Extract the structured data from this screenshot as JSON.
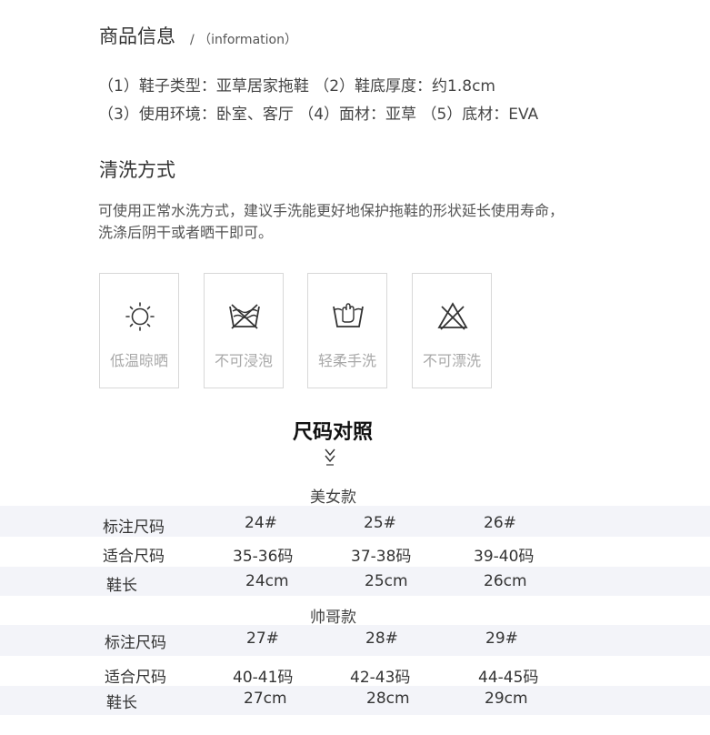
{
  "section_info": {
    "title": "商品信息",
    "title_sub": "/ （information）",
    "line1": "（1）鞋子类型：亚草居家拖鞋 （2）鞋底厚度：约1.8cm",
    "line2": "（3）使用环境：卧室、客厅 （4）面材：亚草 （5）底材：EVA"
  },
  "section_wash": {
    "title": "清洗方式",
    "desc_line1": "可使用正常水洗方式，建议手洗能更好地保护拖鞋的形状延长使用寿命，",
    "desc_line2": "洗涤后阴干或者晒干即可。",
    "care_items": [
      {
        "icon": "sun-icon",
        "label": "低温晾晒"
      },
      {
        "icon": "no-soak-icon",
        "label": "不可浸泡"
      },
      {
        "icon": "hand-wash-icon",
        "label": "轻柔手洗"
      },
      {
        "icon": "no-bleach-icon",
        "label": "不可漂洗"
      }
    ]
  },
  "size_chart": {
    "title": "尺码对照",
    "women": {
      "label": "美女款",
      "rows": [
        {
          "label": "标注尺码",
          "values": [
            "24#",
            "25#",
            "26#"
          ]
        },
        {
          "label": "适合尺码",
          "values": [
            "35-36码",
            "37-38码",
            "39-40码"
          ]
        },
        {
          "label": "鞋长",
          "values": [
            "24cm",
            "25cm",
            "26cm"
          ]
        }
      ]
    },
    "men": {
      "label": "帅哥款",
      "rows": [
        {
          "label": "标注尺码",
          "values": [
            "27#",
            "28#",
            "29#"
          ]
        },
        {
          "label": "适合尺码",
          "values": [
            "40-41码",
            "42-43码",
            "44-45码"
          ]
        },
        {
          "label": "鞋长",
          "values": [
            "27cm",
            "28cm",
            "29cm"
          ]
        }
      ]
    }
  }
}
